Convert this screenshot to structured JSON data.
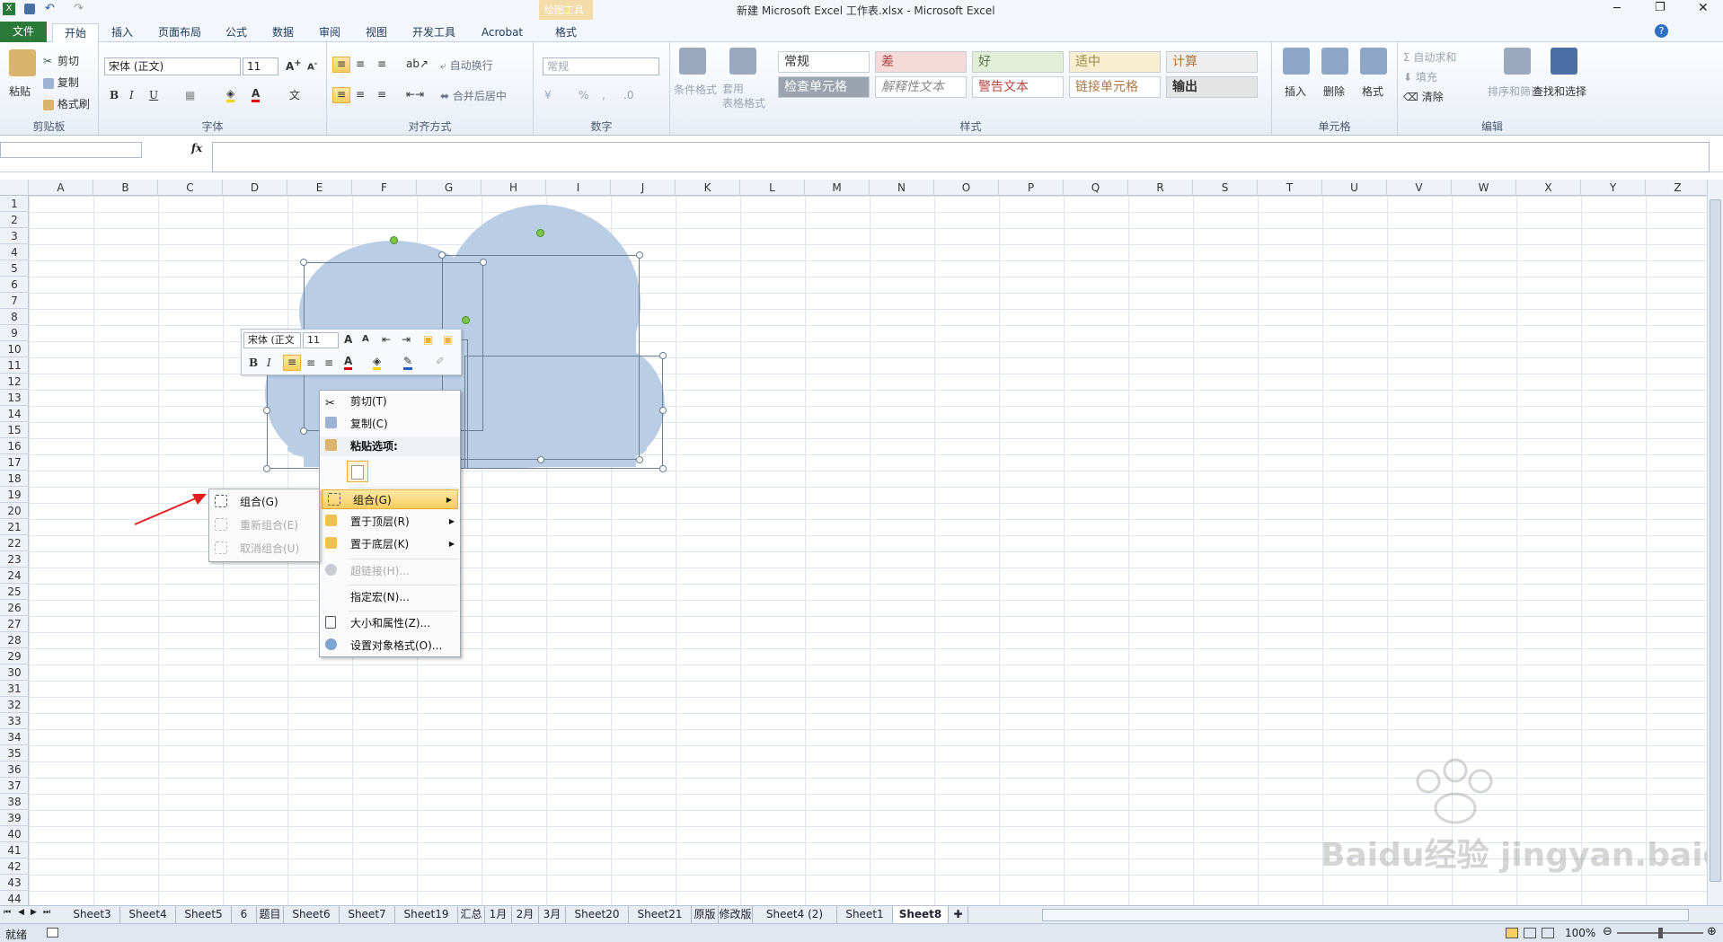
{
  "window": {
    "title": "新建 Microsoft Excel 工作表.xlsx - Microsoft Excel",
    "context_tab_group": "绘图工具"
  },
  "tabs": [
    "文件",
    "开始",
    "插入",
    "页面布局",
    "公式",
    "数据",
    "审阅",
    "视图",
    "开发工具",
    "Acrobat",
    "格式"
  ],
  "ribbon": {
    "clipboard": {
      "label": "剪贴板",
      "paste": "粘贴",
      "cut": "剪切",
      "copy": "复制",
      "format_painter": "格式刷"
    },
    "font": {
      "label": "字体",
      "font_name": "宋体 (正文)",
      "font_size": "11"
    },
    "alignment": {
      "label": "对齐方式",
      "wrap": "自动换行",
      "merge": "合并后居中"
    },
    "number": {
      "label": "数字",
      "format": "常规"
    },
    "styles": {
      "label": "样式",
      "conditional": "条件格式",
      "table_format": "套用\n表格格式",
      "cells": [
        "常规",
        "差",
        "好",
        "适中",
        "计算",
        "检查单元格",
        "解释性文本",
        "警告文本",
        "链接单元格",
        "输出"
      ]
    },
    "cells": {
      "label": "单元格",
      "insert": "插入",
      "delete": "删除",
      "format": "格式"
    },
    "editing": {
      "label": "编辑",
      "autosum": "自动求和",
      "fill": "填充",
      "clear": "清除",
      "sort": "排序和筛选",
      "find": "查找和选择"
    }
  },
  "formula_bar": {
    "fx": "fx",
    "name_box": "",
    "formula": ""
  },
  "columns": [
    "A",
    "B",
    "C",
    "D",
    "E",
    "F",
    "G",
    "H",
    "I",
    "J",
    "K",
    "L",
    "M",
    "N",
    "O",
    "P",
    "Q",
    "R",
    "S",
    "T",
    "U",
    "V",
    "W",
    "X",
    "Y",
    "Z"
  ],
  "rows": [
    "1",
    "2",
    "3",
    "4",
    "5",
    "6",
    "7",
    "8",
    "9",
    "10",
    "11",
    "12",
    "13",
    "14",
    "15",
    "16",
    "17",
    "18",
    "19",
    "20",
    "21",
    "22",
    "23",
    "24",
    "25",
    "26",
    "27",
    "28",
    "29",
    "30",
    "31",
    "32",
    "33",
    "34",
    "35",
    "36",
    "37",
    "38",
    "39",
    "40",
    "41",
    "42",
    "43",
    "44"
  ],
  "mini_toolbar": {
    "font": "宋体 (正文",
    "size": "11"
  },
  "context_menu": {
    "items": [
      "剪切(T)",
      "复制(C)",
      "粘贴选项:",
      "组合(G)",
      "置于顶层(R)",
      "置于底层(K)",
      "超链接(H)...",
      "指定宏(N)...",
      "大小和属性(Z)...",
      "设置对象格式(O)..."
    ]
  },
  "submenu": {
    "items": [
      "组合(G)",
      "重新组合(E)",
      "取消组合(U)"
    ]
  },
  "sheet_tabs": [
    "Sheet3",
    "Sheet4",
    "Sheet5",
    "6",
    "题目",
    "Sheet6",
    "Sheet7",
    "Sheet19",
    "汇总",
    "1月",
    "2月",
    "3月",
    "Sheet20",
    "Sheet21",
    "原版",
    "修改版",
    "Sheet4 (2)",
    "Sheet1",
    "Sheet8"
  ],
  "status": {
    "ready": "就绪",
    "zoom": "100%"
  },
  "watermark": "Baidu经验 jingyan.baidu.com",
  "colors": {
    "cloud": "#b9cde5",
    "accent": "#2b7a3a",
    "highlight": "#f8cd62",
    "arrow": "#e02020"
  }
}
